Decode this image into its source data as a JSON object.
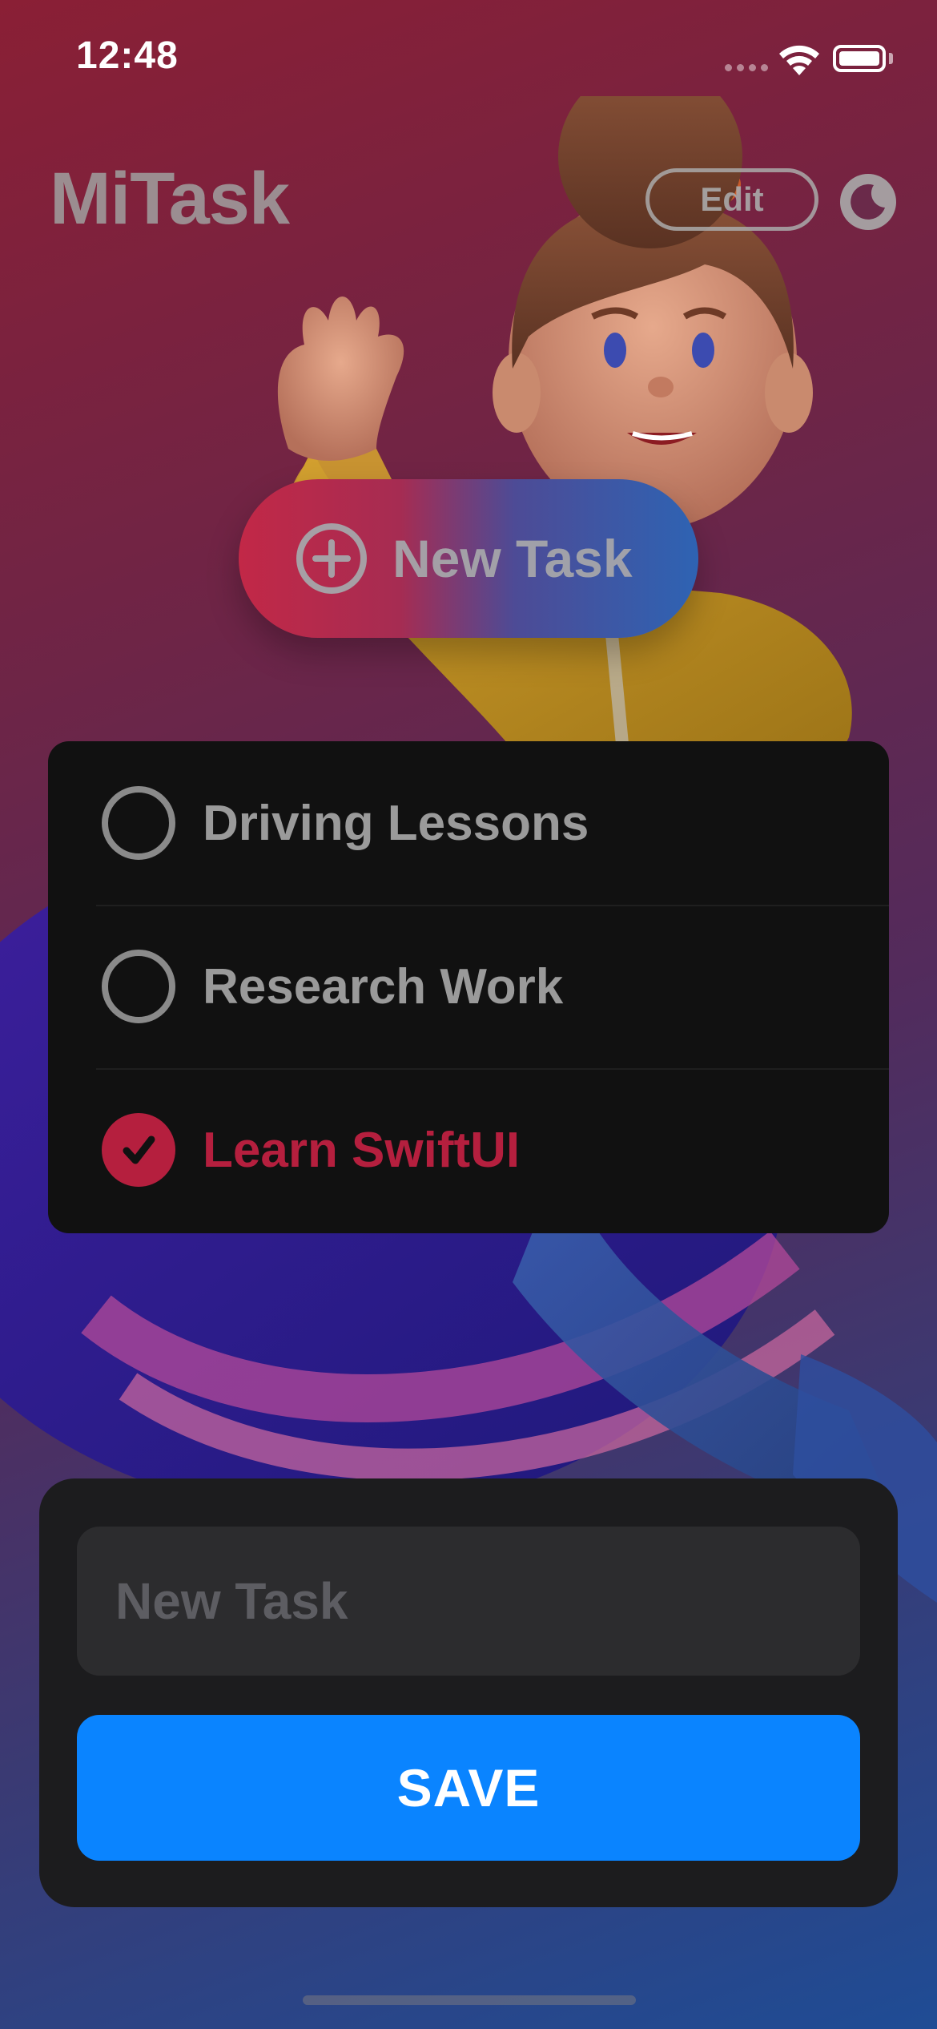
{
  "status_bar": {
    "time": "12:48"
  },
  "header": {
    "app_title": "MiTask",
    "edit_label": "Edit",
    "theme_icon": "moon-icon"
  },
  "new_task_button": {
    "label": "New Task",
    "icon": "plus-circle-icon"
  },
  "tasks": [
    {
      "title": "Driving Lessons",
      "completed": false
    },
    {
      "title": "Research Work",
      "completed": false
    },
    {
      "title": "Learn SwiftUI",
      "completed": true
    }
  ],
  "entry": {
    "placeholder": "New Task",
    "value": "",
    "save_label": "SAVE"
  },
  "colors": {
    "accent_red": "#b51f3e",
    "save_blue": "#0a84ff",
    "card_bg": "#111111",
    "sheet_bg": "#1c1c1e"
  }
}
